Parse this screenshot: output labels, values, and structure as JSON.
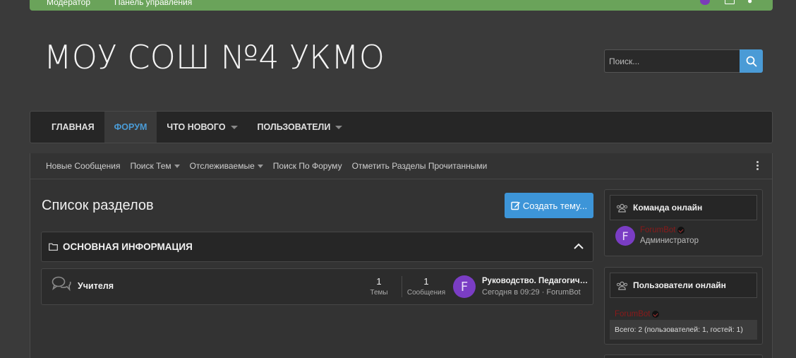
{
  "topbar": {
    "link1": "Модератор",
    "link2": "Панель управления"
  },
  "site": {
    "logo": "МОУ СОШ №4 УКМО"
  },
  "search": {
    "placeholder": "Поиск..."
  },
  "nav": [
    {
      "label": "ГЛАВНАЯ"
    },
    {
      "label": "ФОРУМ"
    },
    {
      "label": "ЧТО НОВОГО"
    },
    {
      "label": "ПОЛЬЗОВАТЕЛИ"
    }
  ],
  "subnav": [
    {
      "label": "Новые Сообщения"
    },
    {
      "label": "Поиск Тем"
    },
    {
      "label": "Отслеживаемые"
    },
    {
      "label": "Поиск По Форуму"
    },
    {
      "label": "Отметить Разделы Прочитанными"
    }
  ],
  "main": {
    "title": "Список разделов",
    "create_label": "Создать тему...",
    "category": "ОСНОВНАЯ ИНФОРМАЦИЯ",
    "forum": {
      "name": "Учителя",
      "threads_count": "1",
      "threads_label": "Темы",
      "messages_count": "1",
      "messages_label": "Сообщения",
      "avatar_letter": "F",
      "last_title": "Руководство. Педагогический состав",
      "last_meta": "Сегодня в 09:29 · ForumBot"
    }
  },
  "sidebar": {
    "staff": {
      "title": "Команда онлайн",
      "avatar_letter": "F",
      "user": "ForumBot",
      "role": "Администратор"
    },
    "online": {
      "title": "Пользователи онлайн",
      "user": "ForumBot",
      "total": "Всего: 2 (пользователей: 1, гостей: 1)"
    }
  },
  "colors": {
    "accent": "#4a9bd6",
    "topbar": "#6aa35a",
    "avatar": "#7a3dc4",
    "username": "#8a1a1a"
  }
}
